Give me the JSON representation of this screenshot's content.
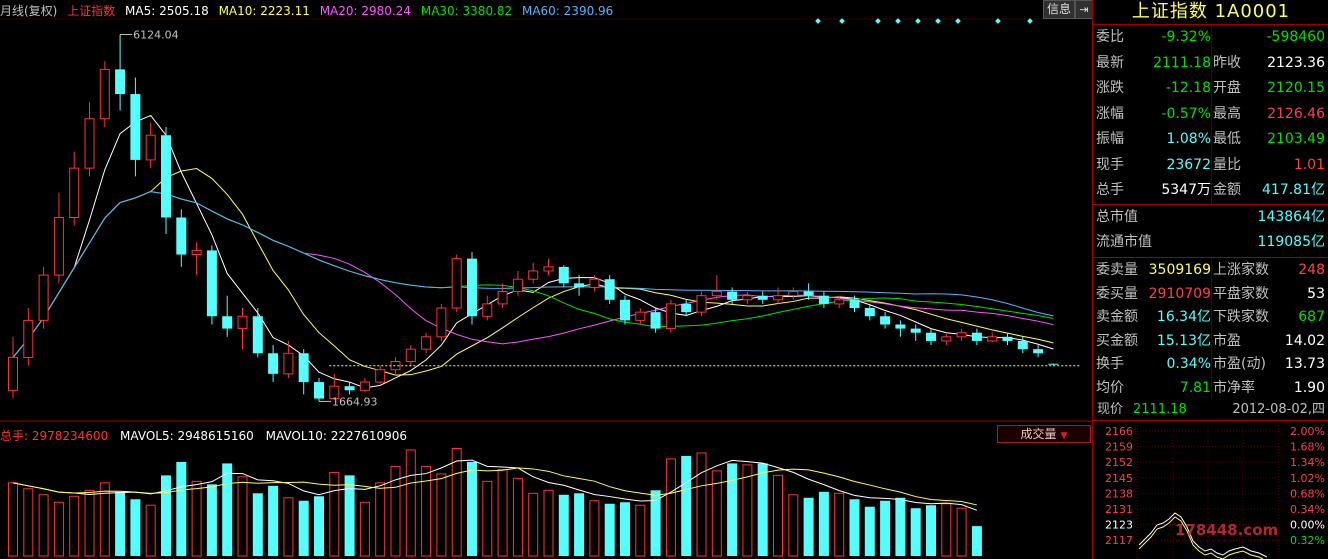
{
  "legend": {
    "period": "月线(复权)",
    "index_name": "上证指数",
    "ma5": "MA5: 2505.18",
    "ma10": "MA10: 2223.11",
    "ma20": "MA20: 2980.24",
    "ma30": "MA30: 3380.82",
    "ma60": "MA60: 2390.96"
  },
  "toolbar": {
    "info_label": "信息",
    "exit_label": "⇥"
  },
  "annotations": {
    "high_label": "6124.04",
    "low_label": "1664.93"
  },
  "volume_legend": {
    "total": "总手: 2978234600",
    "mavol5": "MAVOL5: 2948615160",
    "mavol10": "MAVOL10: 2227610906",
    "selector": "成交量"
  },
  "colors": {
    "up": "#ff3232",
    "down": "#54ffff",
    "ma5": "#ffffff",
    "ma10": "#ffff54",
    "ma20": "#ff54ff",
    "ma30": "#00e000",
    "ma60": "#54b4ff",
    "frame": "#a00000"
  },
  "chart_data": {
    "type": "candlestick",
    "title": "上证指数 月线(复权)",
    "ylim": [
      1500,
      6300
    ],
    "high": 6124.04,
    "low": 1664.93,
    "candles": [
      [
        1800,
        2200,
        1700,
        2450
      ],
      [
        2200,
        2650,
        2100,
        2800
      ],
      [
        2650,
        3200,
        2550,
        3300
      ],
      [
        3200,
        3900,
        3100,
        4200
      ],
      [
        3900,
        4500,
        3800,
        4700
      ],
      [
        4500,
        5100,
        4400,
        5300
      ],
      [
        5100,
        5700,
        5000,
        5800
      ],
      [
        5700,
        5400,
        5200,
        6124.04
      ],
      [
        5400,
        4600,
        4400,
        5600
      ],
      [
        4600,
        4900,
        4500,
        5050
      ],
      [
        4900,
        3900,
        3700,
        5000
      ],
      [
        3900,
        3450,
        3300,
        4000
      ],
      [
        3450,
        3500,
        3200,
        3600
      ],
      [
        3500,
        2700,
        2600,
        3560
      ],
      [
        2700,
        2550,
        2450,
        2950
      ],
      [
        2550,
        2700,
        2300,
        2800
      ],
      [
        2700,
        2250,
        2200,
        2800
      ],
      [
        2250,
        2000,
        1900,
        2350
      ],
      [
        2000,
        2250,
        1950,
        2400
      ],
      [
        2250,
        1900,
        1750,
        2300
      ],
      [
        1900,
        1700,
        1664.93,
        1950
      ],
      [
        1700,
        1850,
        1680,
        2000
      ],
      [
        1850,
        1800,
        1750,
        1900
      ],
      [
        1800,
        1900,
        1780,
        1950
      ],
      [
        1900,
        2050,
        1880,
        2100
      ],
      [
        2050,
        2150,
        2000,
        2200
      ],
      [
        2150,
        2300,
        2100,
        2350
      ],
      [
        2300,
        2450,
        2250,
        2500
      ],
      [
        2450,
        2800,
        2400,
        2850
      ],
      [
        2800,
        3400,
        2750,
        3450
      ],
      [
        3400,
        2700,
        2600,
        3480
      ],
      [
        2700,
        2850,
        2650,
        2950
      ],
      [
        2850,
        3000,
        2800,
        3100
      ],
      [
        3000,
        3150,
        2950,
        3250
      ],
      [
        3150,
        3250,
        3100,
        3350
      ],
      [
        3250,
        3300,
        3200,
        3400
      ],
      [
        3300,
        3100,
        3050,
        3320
      ],
      [
        3100,
        3050,
        2950,
        3200
      ],
      [
        3050,
        3150,
        3000,
        3200
      ],
      [
        3150,
        2900,
        2850,
        3200
      ],
      [
        2900,
        2650,
        2600,
        2950
      ],
      [
        2650,
        2750,
        2600,
        2800
      ],
      [
        2750,
        2550,
        2500,
        2800
      ],
      [
        2550,
        2850,
        2500,
        2900
      ],
      [
        2850,
        2750,
        2700,
        2900
      ],
      [
        2750,
        2950,
        2700,
        3000
      ],
      [
        2950,
        3000,
        2900,
        3200
      ],
      [
        3000,
        2900,
        2850,
        3050
      ],
      [
        2900,
        2950,
        2850,
        3000
      ],
      [
        2950,
        2900,
        2850,
        3000
      ],
      [
        2900,
        2950,
        2850,
        3050
      ],
      [
        2950,
        3000,
        2900,
        3050
      ],
      [
        3000,
        2950,
        2900,
        3100
      ],
      [
        2950,
        2850,
        2800,
        3000
      ],
      [
        2850,
        2900,
        2800,
        2950
      ],
      [
        2900,
        2800,
        2750,
        2950
      ],
      [
        2800,
        2700,
        2650,
        2850
      ],
      [
        2700,
        2600,
        2550,
        2750
      ],
      [
        2600,
        2550,
        2450,
        2650
      ],
      [
        2550,
        2500,
        2400,
        2600
      ],
      [
        2500,
        2400,
        2350,
        2550
      ],
      [
        2400,
        2450,
        2350,
        2500
      ],
      [
        2450,
        2500,
        2400,
        2550
      ],
      [
        2500,
        2400,
        2350,
        2550
      ],
      [
        2400,
        2450,
        2380,
        2500
      ],
      [
        2450,
        2400,
        2350,
        2500
      ],
      [
        2400,
        2300,
        2250,
        2450
      ],
      [
        2300,
        2250,
        2200,
        2350
      ],
      [
        2123.36,
        2111.18,
        2103.49,
        2126.46
      ]
    ],
    "volume": [
      4.9,
      4.5,
      4.1,
      3.6,
      4.0,
      4.4,
      4.9,
      4.3,
      3.8,
      3.4,
      5.4,
      6.3,
      5.0,
      4.8,
      6.2,
      5.3,
      4.2,
      4.7,
      3.9,
      3.7,
      4.0,
      5.6,
      5.4,
      3.6,
      4.9,
      6.0,
      7.1,
      6.0,
      5.5,
      7.2,
      6.3,
      5.0,
      5.8,
      5.2,
      4.2,
      4.4,
      4.1,
      4.2,
      3.7,
      3.5,
      3.6,
      3.4,
      4.4,
      6.5,
      6.7,
      6.9,
      5.7,
      6.2,
      6.1,
      6.2,
      5.4,
      4.1,
      3.9,
      4.3,
      4.2,
      3.8,
      3.3,
      3.7,
      3.9,
      3.2,
      3.4,
      3.5,
      3.2,
      2.0
    ]
  },
  "panel": {
    "title": "上证指数 1A0001",
    "rows": [
      {
        "l1": "委比",
        "v1": "-9.32%",
        "l2": "",
        "v2": "-598460"
      },
      {
        "l1": "最新",
        "v1": "2111.18",
        "l2": "昨收",
        "v2": "2123.36"
      },
      {
        "l1": "涨跌",
        "v1": "-12.18",
        "l2": "开盘",
        "v2": "2120.15"
      },
      {
        "l1": "涨幅",
        "v1": "-0.57%",
        "l2": "最高",
        "v2": "2126.46"
      },
      {
        "l1": "振幅",
        "v1": "1.08%",
        "l2": "最低",
        "v2": "2103.49"
      },
      {
        "l1": "现手",
        "v1": "23672",
        "l2": "量比",
        "v2": "1.01"
      },
      {
        "l1": "总手",
        "v1": "5347万",
        "l2": "金额",
        "v2": "417.81亿"
      }
    ],
    "cap": [
      {
        "label": "总市值",
        "value": "143864亿"
      },
      {
        "label": "流通市值",
        "value": "119085亿"
      }
    ],
    "stats": [
      {
        "l1": "委卖量",
        "v1": "3509169",
        "l2": "上涨家数",
        "v2": "248"
      },
      {
        "l1": "委买量",
        "v1": "2910709",
        "l2": "平盘家数",
        "v2": "53"
      },
      {
        "l1": "卖金额",
        "v1": "16.34亿",
        "l2": "下跌家数",
        "v2": "687"
      },
      {
        "l1": "买金额",
        "v1": "15.13亿",
        "l2": "市盈",
        "v2": "14.02"
      },
      {
        "l1": "换手",
        "v1": "0.34%",
        "l2": "市盈(动)",
        "v2": "13.73"
      },
      {
        "l1": "均价",
        "v1": "7.81",
        "l2": "市净率",
        "v2": "1.90"
      }
    ],
    "mini": {
      "now_label": "现价",
      "now_value": "2111.18",
      "date": "2012-08-02,四",
      "left_ticks": [
        "2166",
        "2159",
        "2152",
        "2145",
        "2138",
        "2131",
        "2123",
        "2117"
      ],
      "right_ticks": [
        "2.00%",
        "1.68%",
        "1.34%",
        "1.02%",
        "0.68%",
        "0.34%",
        "0.00%",
        "0.32%"
      ],
      "watermark": "178448.com"
    }
  }
}
